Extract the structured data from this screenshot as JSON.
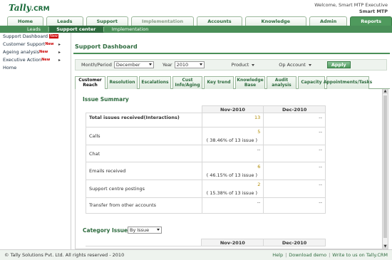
{
  "header": {
    "logo_brand": "Tally",
    "logo_product": ".CRM",
    "welcome": "Welcome, Smart MTP Executive",
    "company": "Smart MTP"
  },
  "main_tabs": [
    "Home",
    "Leads",
    "Support",
    "Implementation",
    "Accounts",
    "Knowledge Base",
    "Admin",
    "Reports"
  ],
  "sub_nav": [
    "Leads",
    "Support center",
    "Implementation"
  ],
  "sidebar": [
    {
      "label": "Support Dashboard",
      "badge": "New",
      "arrow": ""
    },
    {
      "label": "Customer Support",
      "badge": "New",
      "arrow": "▸"
    },
    {
      "label": "Ageing analysis",
      "badge": "New",
      "arrow": "▸"
    },
    {
      "label": "Executive Action",
      "badge": "New",
      "arrow": "▸"
    },
    {
      "label": "Home",
      "badge": "",
      "arrow": ""
    }
  ],
  "dashboard": {
    "title": "Support Dashboard",
    "month_label": "Month/Period",
    "month_value": "December",
    "year_label": "Year",
    "year_value": "2010",
    "product_label": "Product",
    "op_account_label": "Op Account",
    "apply_label": "Apply"
  },
  "subtabs": [
    "Customer Reach",
    "Resolution",
    "Escalations",
    "Cust Info/Aging",
    "Key trend",
    "Knowledge Base",
    "Audit analysis",
    "Capacity",
    "Appointments/Tasks"
  ],
  "issue_summary": {
    "title": "Issue Summary",
    "columns": [
      "Nov-2010",
      "Dec-2010"
    ],
    "rows": [
      {
        "label": "Total issues received(Interactions)",
        "nov": "13",
        "nov_pct": "",
        "dec": "--"
      },
      {
        "label": "Calls",
        "nov": "5",
        "nov_pct": "( 38.46% of 13 issue )",
        "dec": "--"
      },
      {
        "label": "Chat",
        "nov": "--",
        "nov_pct": "",
        "dec": "--"
      },
      {
        "label": "Emails received",
        "nov": "6",
        "nov_pct": "( 46.15% of 13 issue )",
        "dec": "--"
      },
      {
        "label": "Support centre postings",
        "nov": "2",
        "nov_pct": "( 15.38% of 13 issue )",
        "dec": "--"
      },
      {
        "label": "Transfer from other accounts",
        "nov": "--",
        "nov_pct": "",
        "dec": "--"
      }
    ]
  },
  "category_issues": {
    "title": "Category Issues",
    "select_value": "By Issue",
    "columns": [
      "Nov-2010",
      "Dec-2010"
    ]
  },
  "footer": {
    "copyright": "© Tally Solutions Pvt. Ltd. All rights reserved - 2010",
    "links": [
      "Help",
      "Download demo",
      "Write to us on Tally.CRM"
    ]
  }
}
